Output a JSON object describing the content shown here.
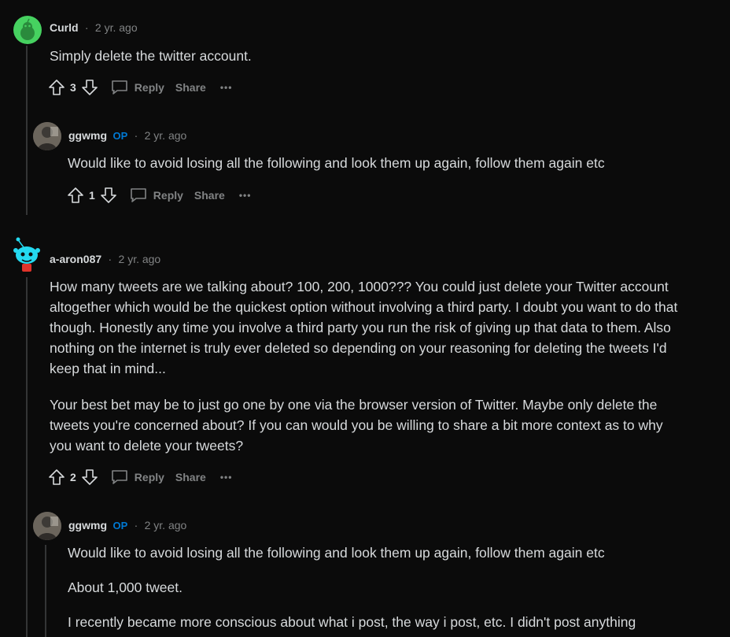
{
  "comments": [
    {
      "user": "Curld",
      "time": "2 yr. ago",
      "body": [
        "Simply delete the twitter account."
      ],
      "score": "3",
      "reply": "Reply",
      "share": "Share",
      "more": "•••"
    },
    {
      "user": "ggwmg",
      "op": "OP",
      "time": "2 yr. ago",
      "body": [
        "Would like to avoid losing all the following and look them up again, follow them again etc"
      ],
      "score": "1",
      "reply": "Reply",
      "share": "Share",
      "more": "•••"
    },
    {
      "user": "a-aron087",
      "time": "2 yr. ago",
      "body": [
        "How many tweets are we talking about? 100, 200, 1000??? You could just delete your Twitter account altogether which would be the quickest option without involving a third party. I doubt you want to do that though. Honestly any time you involve a third party you run the risk of giving up that data to them. Also nothing on the internet is truly ever deleted so depending on your reasoning for deleting the tweets I'd keep that in mind...",
        "Your best bet may be to just go one by one via the browser version of Twitter. Maybe only delete the tweets you're concerned about? If you can would you be willing to share a bit more context as to why you want to delete your tweets?"
      ],
      "score": "2",
      "reply": "Reply",
      "share": "Share",
      "more": "•••"
    },
    {
      "user": "ggwmg",
      "op": "OP",
      "time": "2 yr. ago",
      "body": [
        "Would like to avoid losing all the following and look them up again, follow them again etc",
        "About 1,000 tweet.",
        "I recently became more conscious about what i post, the way i post, etc. I didn't post anything"
      ]
    }
  ],
  "colors": {
    "accent_op": "#0079d3",
    "muted": "#818384",
    "text": "#d7dadc"
  }
}
